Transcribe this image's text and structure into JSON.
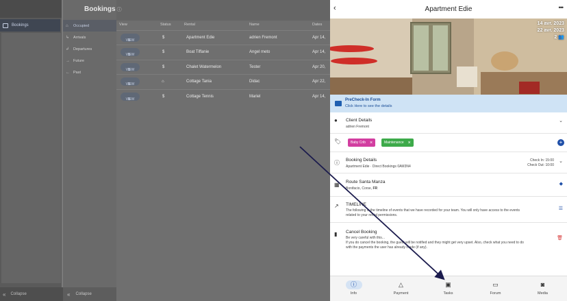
{
  "left_sidebar": {
    "active_item": "Bookings",
    "collapse_label": "Collapse"
  },
  "sub_sidebar": {
    "items": [
      {
        "label": "Occupied",
        "icon": "home-icon"
      },
      {
        "label": "Arrivals",
        "icon": "arrival-icon"
      },
      {
        "label": "Departures",
        "icon": "departure-icon"
      },
      {
        "label": "Future",
        "icon": "future-icon"
      },
      {
        "label": "Past",
        "icon": "past-icon"
      }
    ],
    "collapse_label": "Collapse"
  },
  "bookings": {
    "title": "Bookings",
    "columns": {
      "view": "View",
      "status": "Status",
      "rental": "Rental",
      "name": "Name",
      "dates": "Dates"
    },
    "view_label": "VIEW",
    "rows": [
      {
        "status": "$",
        "rental": "Apartment Edie",
        "name": "adrien Fremont",
        "dates": "Apr 14,"
      },
      {
        "status": "$",
        "rental": "Boat Tiffanie",
        "name": "Angel meto",
        "dates": "Apr 14,"
      },
      {
        "status": "$",
        "rental": "Chalet Watermelon",
        "name": "Tester",
        "dates": "Apr 20,"
      },
      {
        "status": "⌂",
        "rental": "Cottage Tania",
        "name": "Didac",
        "dates": "Apr 22,"
      },
      {
        "status": "$",
        "rental": "Cottage Tennis",
        "name": "Mariel",
        "dates": "Apr 14,"
      }
    ]
  },
  "detail": {
    "title": "Apartment Edie",
    "date_from": "14 avr. 2023",
    "date_to": "22 avr. 2023",
    "guests": "2",
    "precheck": {
      "title": "PreCheck-In Form",
      "subtitle": "Click Here to see the details"
    },
    "client": {
      "title": "Client Details",
      "name": "adrien Fremont"
    },
    "tags": [
      {
        "label": "Baby Crib",
        "color": "#d23ea0"
      },
      {
        "label": "Maintenance",
        "color": "#3daa4a"
      }
    ],
    "booking": {
      "title": "Booking Details",
      "subtitle_rental": "Apartment Edie",
      "subtitle_rest": "· Direct Bookings 0AM3N4",
      "check_in": "Check In: 15:00",
      "check_out": "Check Out: 10:00"
    },
    "route": {
      "title": "Route Santa Manza",
      "city": "Bonifacio, Corse, ",
      "country": "FR"
    },
    "timeline": {
      "title": "TIMELINE",
      "line1": "The following is the timeline of events that we have recorded for your team. You will only have access to the events",
      "line2": "related to your rental permissions."
    },
    "cancel": {
      "title": "Cancel Booking",
      "line1": "Be very careful with this...",
      "line2": "If you do cancel the booking, the guest will be notified and they might get very upset. Also, check what you need to do",
      "line3": "with the payments the user has already made (if any)."
    }
  },
  "bottom_nav": [
    {
      "label": "Info",
      "icon": "info-icon",
      "active": true
    },
    {
      "label": "Payment",
      "icon": "payment-icon",
      "active": false
    },
    {
      "label": "Tasks",
      "icon": "tasks-icon",
      "active": false
    },
    {
      "label": "Forum",
      "icon": "forum-icon",
      "active": false
    },
    {
      "label": "Media",
      "icon": "media-icon",
      "active": false
    }
  ]
}
